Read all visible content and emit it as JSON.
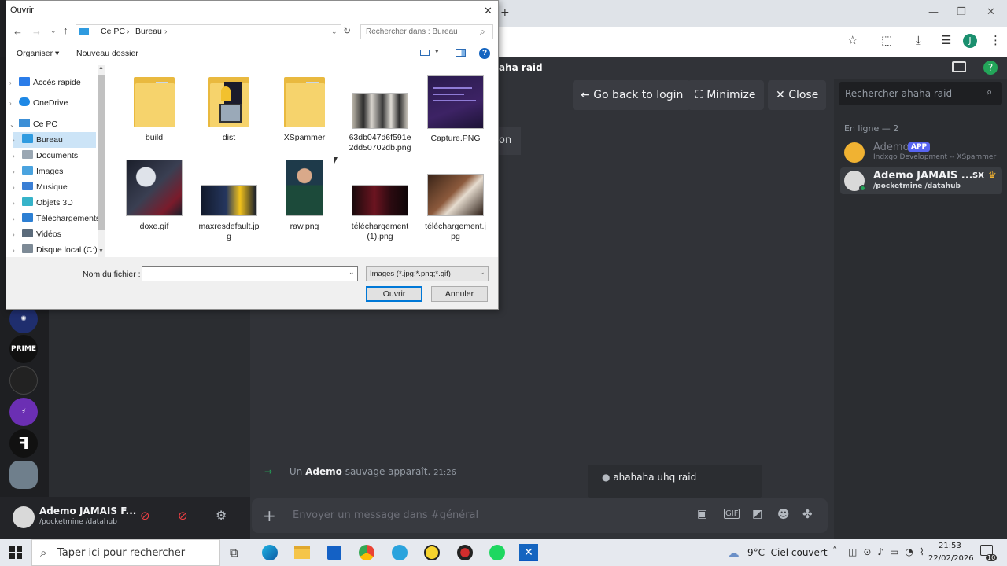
{
  "browser": {
    "new_tab_glyph": "+",
    "minimize_glyph": "—",
    "maximize_glyph": "❐",
    "close_glyph": "✕",
    "profile_letter": "J"
  },
  "discord": {
    "channel_title": "aha raid",
    "partial_button_text": "on",
    "go_back_label": "Go back to login",
    "minimize_label": "Minimize",
    "close_label": "Close",
    "search_placeholder": "Rechercher ahaha raid",
    "online_header": "En ligne — 2",
    "members": [
      {
        "name": "Ademo",
        "badge": "APP",
        "status": "Indxgo Development -- XSpammer"
      },
      {
        "name": "Ademo JAMAIS ...",
        "tag": "SX",
        "status": "/pocketmine /datahub"
      }
    ],
    "message": {
      "prefix": "Un",
      "author": "Ademo",
      "text": "sauvage apparaît.",
      "time": "21:26"
    },
    "popup_item": "ahahaha uhq raid",
    "composer_placeholder": "Envoyer un message dans #général",
    "user": {
      "name": "Ademo JAMAIS F...",
      "status": "/pocketmine /datahub"
    },
    "servers": [
      "",
      "",
      "",
      "",
      "",
      "",
      ""
    ],
    "server_labels": [
      "",
      "PRIME",
      "",
      "",
      "",
      ""
    ]
  },
  "dialog": {
    "title": "Ouvrir",
    "close_glyph": "✕",
    "breadcrumb": [
      "Ce PC",
      "Bureau"
    ],
    "search_placeholder": "Rechercher dans : Bureau",
    "organize_label": "Organiser ▾",
    "new_folder_label": "Nouveau dossier",
    "help_glyph": "?",
    "tree": [
      {
        "label": "Accès rapide",
        "color": "#2b7de9",
        "expanded": false,
        "indent": 0
      },
      {
        "label": "OneDrive",
        "color": "#1e88e5",
        "expanded": false,
        "indent": 0
      },
      {
        "label": "Ce PC",
        "color": "#3c8fd6",
        "expanded": true,
        "indent": 0
      },
      {
        "label": "Bureau",
        "color": "#2f9be0",
        "expanded": false,
        "indent": 1,
        "selected": true
      },
      {
        "label": "Documents",
        "color": "#9aa7b3",
        "expanded": false,
        "indent": 1
      },
      {
        "label": "Images",
        "color": "#4aa3df",
        "expanded": false,
        "indent": 1
      },
      {
        "label": "Musique",
        "color": "#3a7fd5",
        "expanded": false,
        "indent": 1
      },
      {
        "label": "Objets 3D",
        "color": "#36b3c9",
        "expanded": false,
        "indent": 1
      },
      {
        "label": "Téléchargements",
        "color": "#2d7fd3",
        "expanded": false,
        "indent": 1
      },
      {
        "label": "Vidéos",
        "color": "#5b6b7b",
        "expanded": false,
        "indent": 1
      },
      {
        "label": "Disque local (C:)",
        "color": "#7d8a96",
        "expanded": false,
        "indent": 1
      }
    ],
    "files": [
      {
        "name": "build",
        "kind": "folder"
      },
      {
        "name": "dist",
        "kind": "folder-special"
      },
      {
        "name": "XSpammer",
        "kind": "folder"
      },
      {
        "name": "63db047d6f591e2dd50702db.png",
        "name_lines": [
          "63db047d6f591e",
          "2dd50702db.png"
        ],
        "kind": "photo-people"
      },
      {
        "name": "Capture.PNG",
        "kind": "screenshot-dark"
      },
      {
        "name": "doxe.gif",
        "kind": "gif-dark"
      },
      {
        "name": "maxresdefault.jpg",
        "name_lines": [
          "maxresdefault.jp",
          "g"
        ],
        "kind": "banner-yellow"
      },
      {
        "name": "raw.png",
        "kind": "portrait-green"
      },
      {
        "name": "téléchargement (1).png",
        "name_lines": [
          "téléchargement",
          "(1).png"
        ],
        "kind": "dark-red"
      },
      {
        "name": "téléchargement.jpg",
        "name_lines": [
          "téléchargement.j",
          "pg"
        ],
        "kind": "meeting"
      }
    ],
    "filename_label": "Nom du fichier :",
    "filename_value": "",
    "filter_value": "Images (*.jpg;*.png;*.gif)",
    "open_button": "Ouvrir",
    "cancel_button": "Annuler"
  },
  "taskbar": {
    "search_placeholder": "Taper ici pour rechercher",
    "weather": "9°C  Ciel couvert",
    "time": "21:53",
    "date": "22/02/2026",
    "notification_count": "10",
    "apps": [
      "task-view",
      "edge",
      "file-explorer",
      "store",
      "chrome",
      "telegram",
      "app-yellow",
      "app-red",
      "spotify",
      "app-x"
    ]
  },
  "colors": {
    "discord_bg": "#313338",
    "discord_sidebar": "#2b2d31",
    "accent_blue": "#0067c0",
    "app_badge": "#5865f2",
    "online_green": "#23a559"
  }
}
